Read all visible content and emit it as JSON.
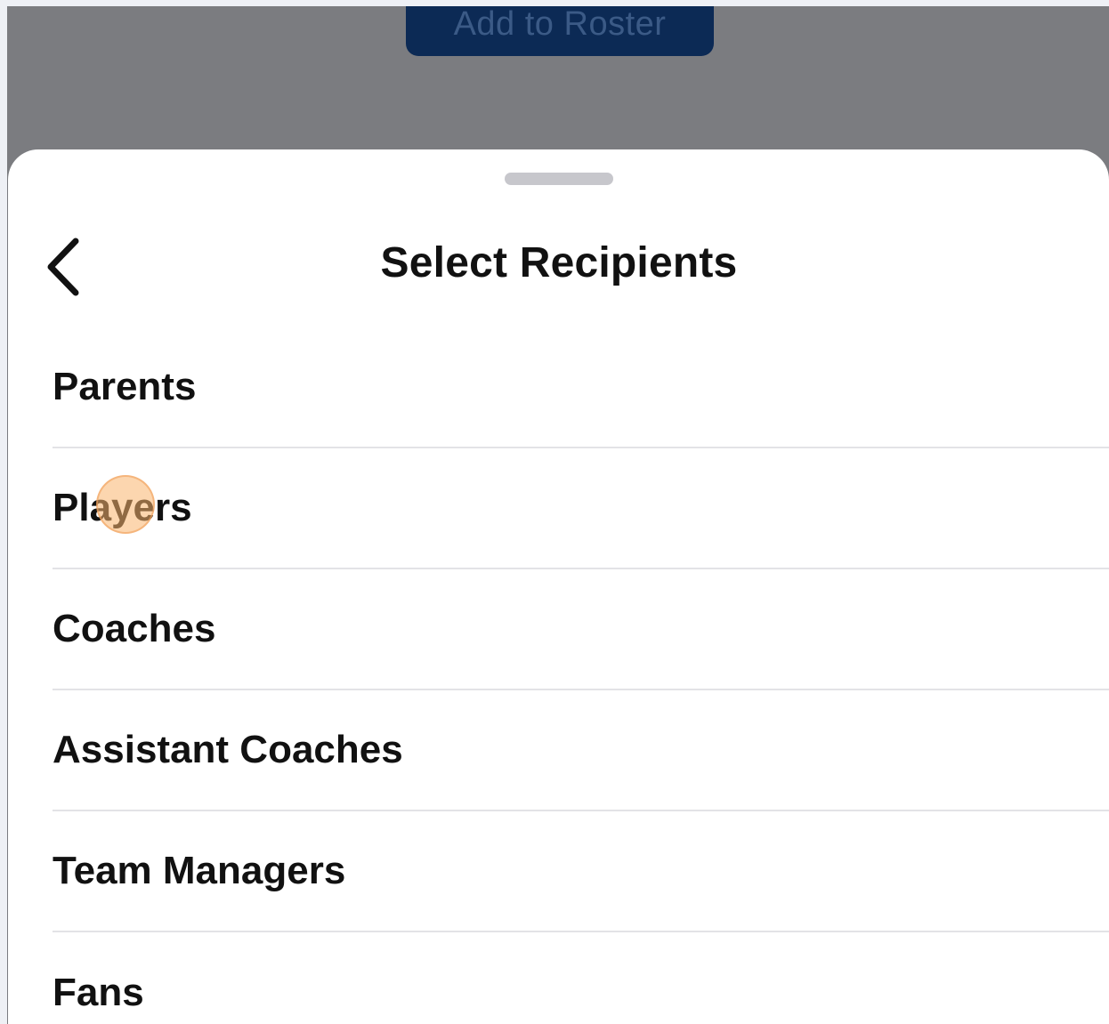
{
  "background": {
    "button_label": "Add to Roster"
  },
  "sheet": {
    "title": "Select Recipients",
    "back_icon": "chevron-left-icon",
    "items": [
      {
        "label": "Parents"
      },
      {
        "label": "Players"
      },
      {
        "label": "Coaches"
      },
      {
        "label": "Assistant Coaches"
      },
      {
        "label": "Team Managers"
      },
      {
        "label": "Fans"
      }
    ]
  },
  "colors": {
    "overlay": "#7b7c80",
    "button_bg": "#0c2a55",
    "text": "#111111",
    "separator": "#e3e3e6",
    "tap_indicator": "#fab46e"
  }
}
